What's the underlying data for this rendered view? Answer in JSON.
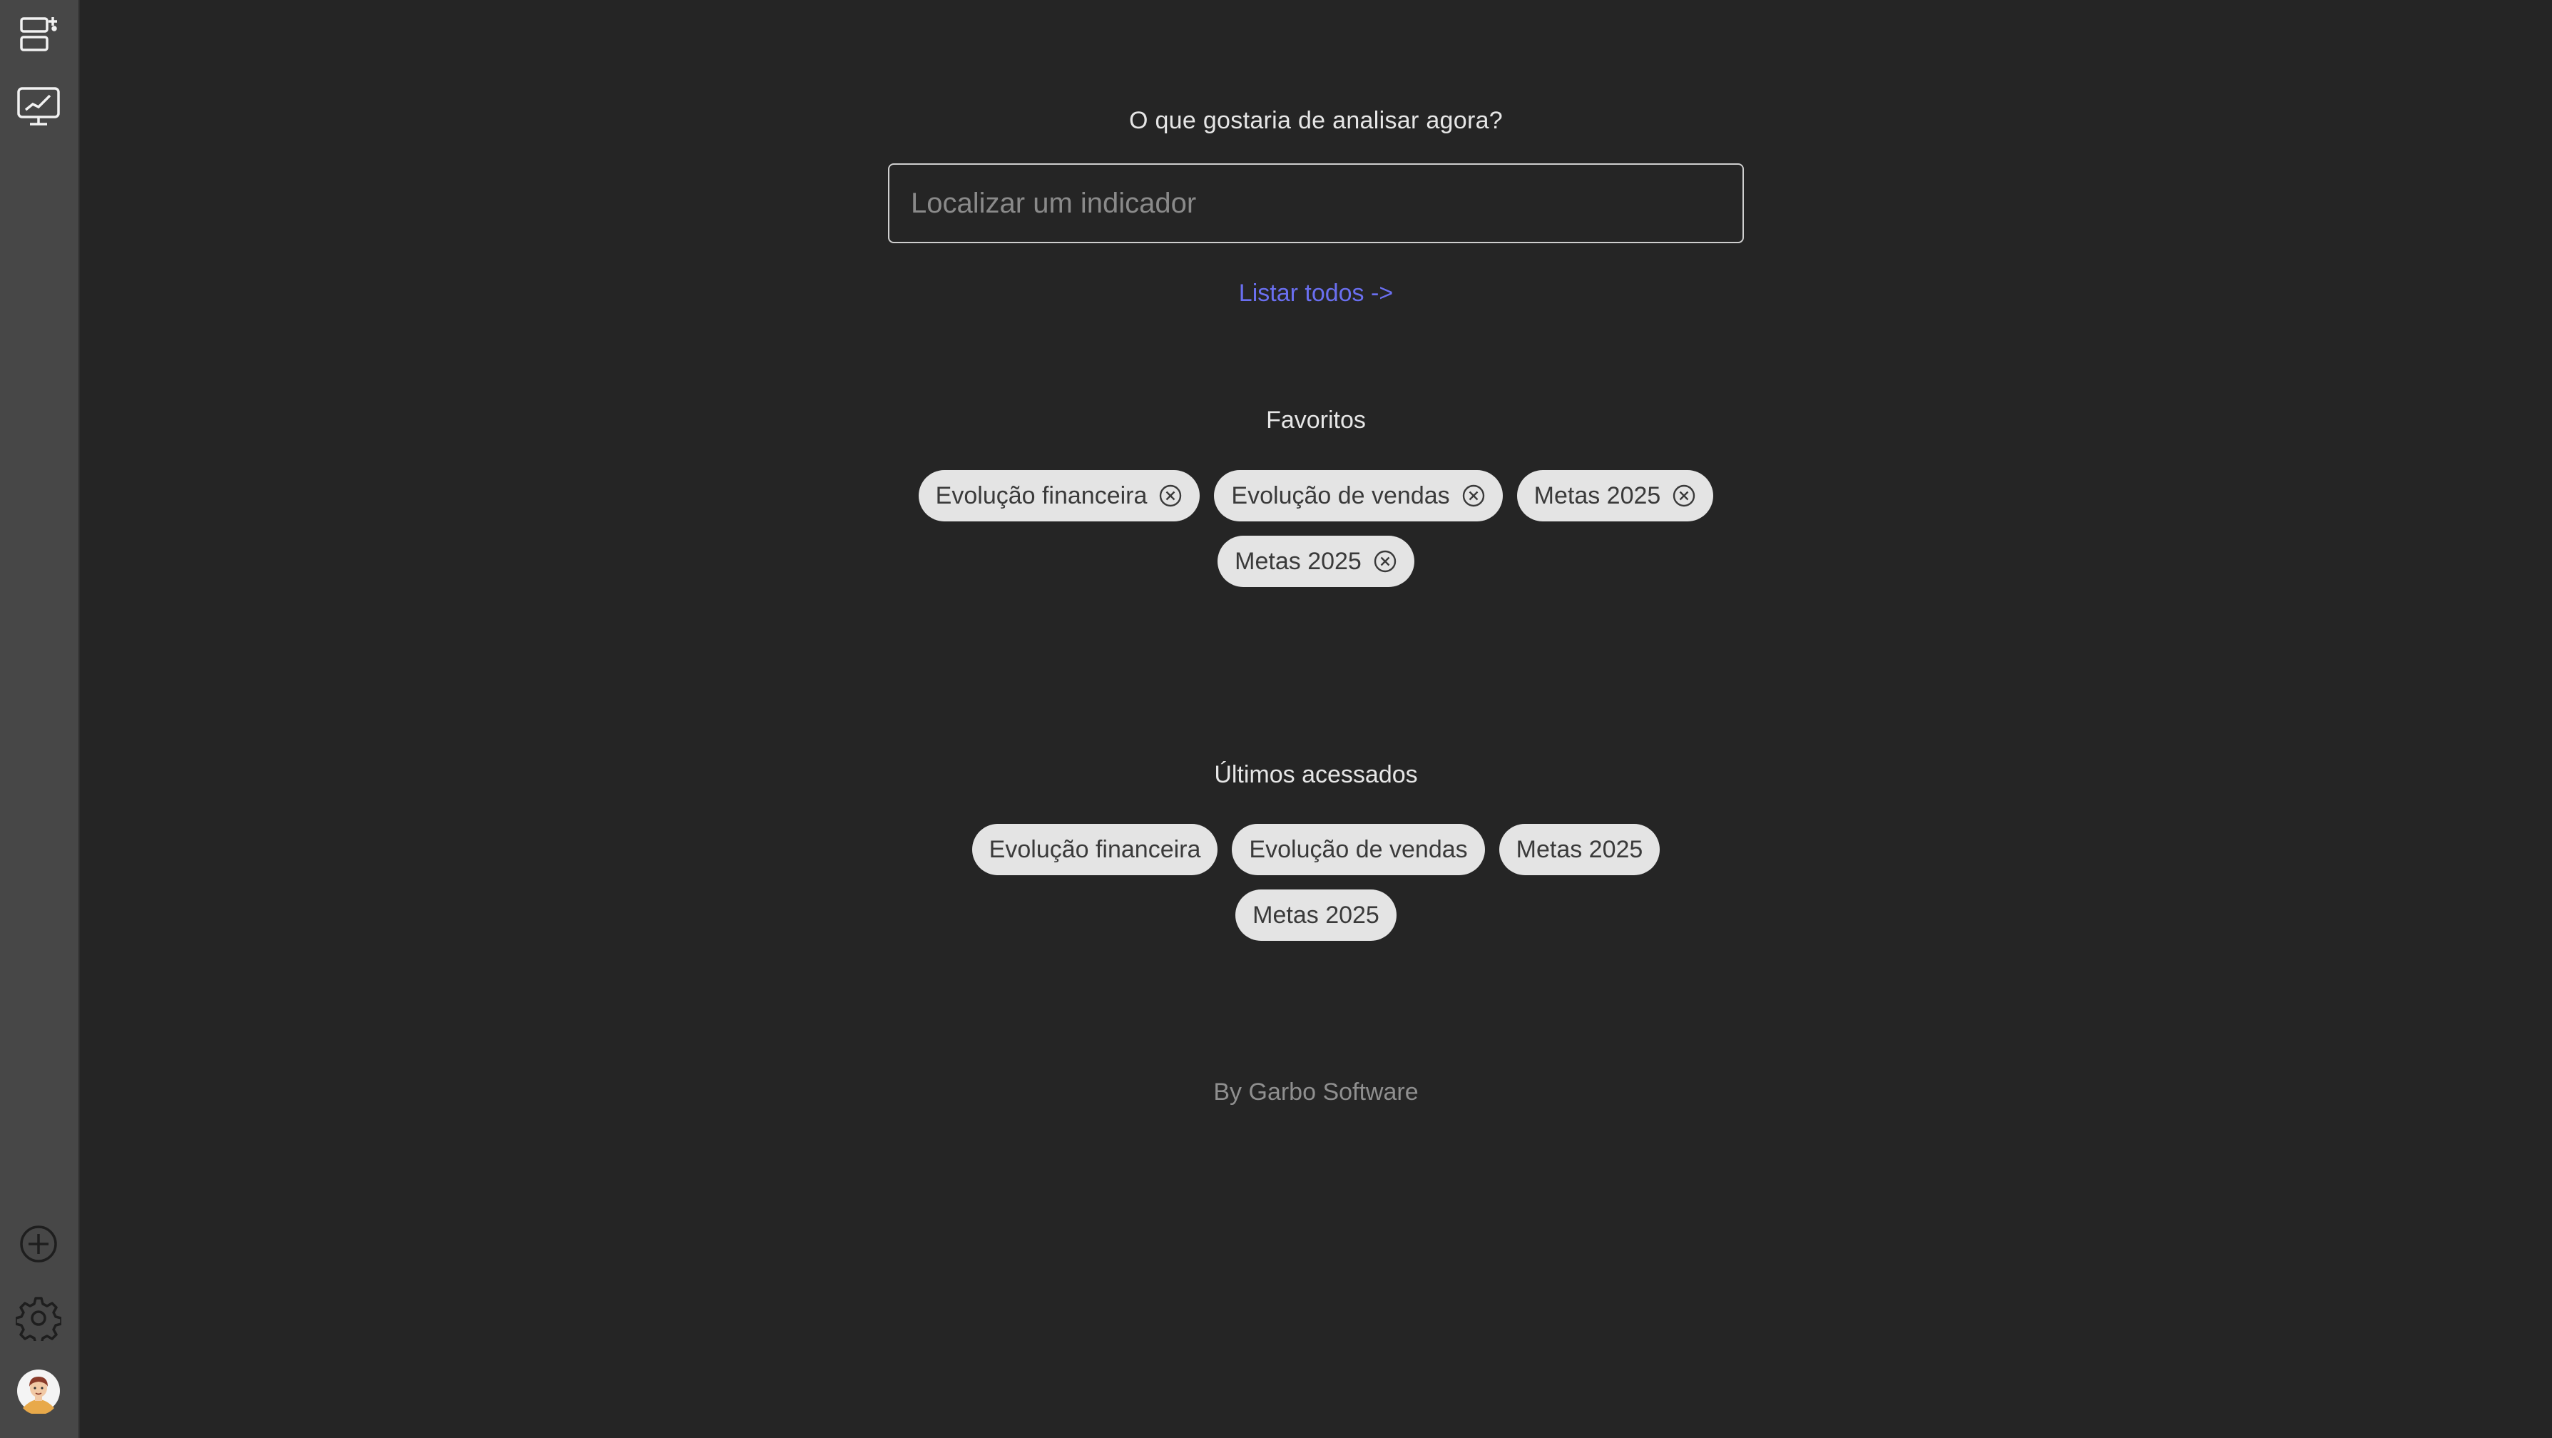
{
  "search": {
    "prompt": "O que gostaria de analisar agora?",
    "placeholder": "Localizar um indicador",
    "value": ""
  },
  "list_all_label": "Listar todos ->",
  "favorites": {
    "title": "Favoritos",
    "items": [
      {
        "label": "Evolução financeira"
      },
      {
        "label": "Evolução de vendas"
      },
      {
        "label": "Metas 2025"
      },
      {
        "label": "Metas 2025"
      }
    ]
  },
  "recent": {
    "title": "Últimos acessados",
    "items": [
      {
        "label": "Evolução financeira"
      },
      {
        "label": "Evolução de vendas"
      },
      {
        "label": "Metas 2025"
      },
      {
        "label": "Metas 2025"
      }
    ]
  },
  "footer": "By Garbo Software",
  "sidebar": {
    "icons": [
      "dashboard-list-icon",
      "chart-monitor-icon",
      "add-circle-icon",
      "gear-icon",
      "user-avatar"
    ]
  },
  "colors": {
    "background": "#252525",
    "sidebar": "#474747",
    "link": "#6a6ff0",
    "chip": "#e4e4e4"
  }
}
